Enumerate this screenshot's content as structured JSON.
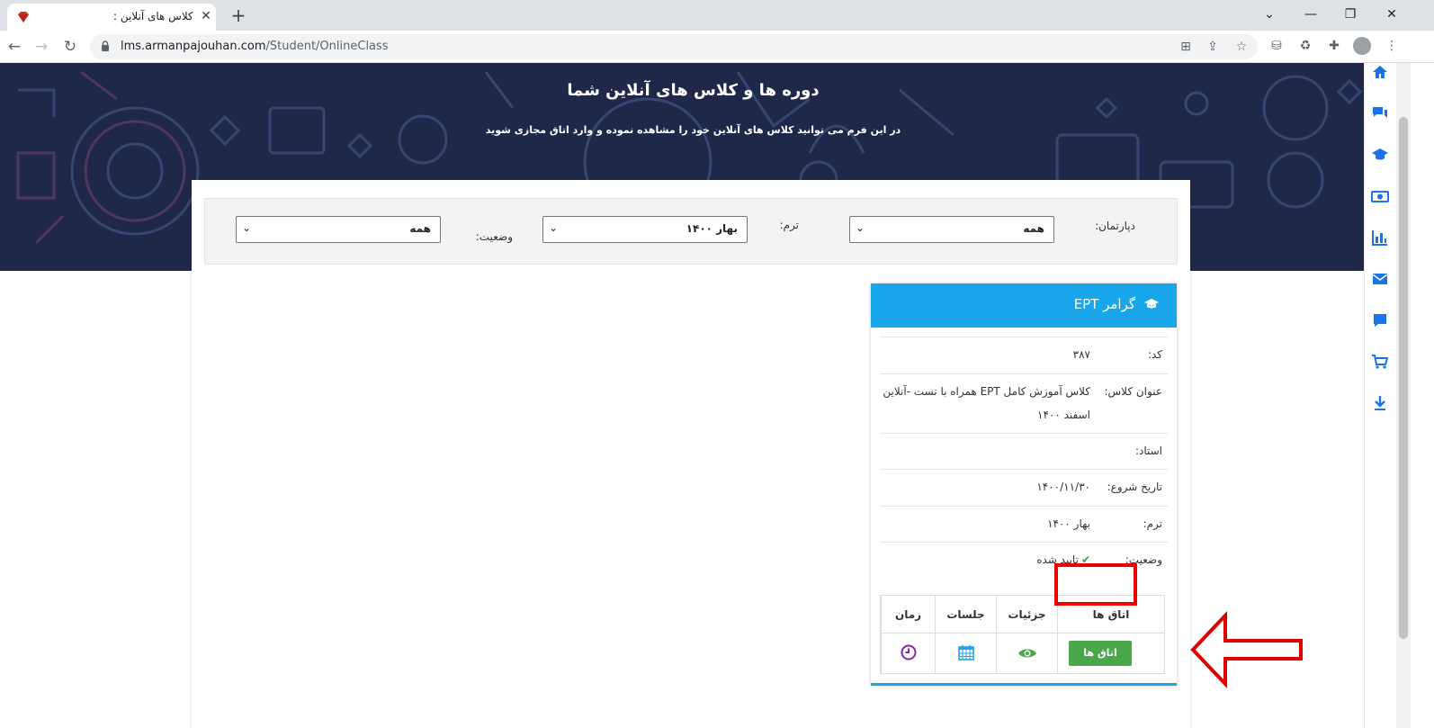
{
  "browser": {
    "tab_title": "کلاس های آنلاین :",
    "tab_close": "✕",
    "new_tab": "+",
    "url_host": "lms.armanpajouhan.com",
    "url_path": "/Student/OnlineClass",
    "controls": {
      "minimize": "—",
      "restore": "❐",
      "close": "✕",
      "tab_list": "⌄"
    },
    "nav": {
      "back": "←",
      "forward": "→",
      "reload": "↻"
    },
    "omni_icons": [
      "translate-icon",
      "share-icon",
      "star-icon"
    ],
    "extension_icons": [
      "extension-a-icon",
      "extension-b-icon",
      "puzzle-icon",
      "profile-icon",
      "menu-icon"
    ]
  },
  "hero": {
    "title": "دوره ها و کلاس های آنلاین شما",
    "subtitle": "در این فرم می توانید کلاس های آنلاین خود را مشاهده نموده و وارد اتاق مجازی شوید"
  },
  "filters": {
    "department_label": "دپارتمان:",
    "department_value": "همه",
    "term_label": "ترم:",
    "term_value": "بهار ۱۴۰۰",
    "status_label": "وضعیت:",
    "status_value": "همه"
  },
  "card": {
    "title": "گرامر EPT",
    "rows": {
      "code_label": "کد:",
      "code_value": "۳۸۷",
      "class_title_label": "عنوان کلاس:",
      "class_title_value": "کلاس آموزش کامل EPT همراه با تست -آنلاین اسفند ۱۴۰۰",
      "teacher_label": "استاد:",
      "teacher_value": "",
      "start_label": "تاریخ شروع:",
      "start_value": "۱۴۰۰/۱۱/۳۰",
      "term_label": "ترم:",
      "term_value": "بهار ۱۴۰۰",
      "status_label": "وضعیت:",
      "status_value": "تایید شده",
      "status_check": "✔"
    },
    "table": {
      "headers": [
        "اتاق ها",
        "جزئیات",
        "جلسات",
        "زمان"
      ],
      "rooms_button": "اتاق ها"
    }
  },
  "colors": {
    "hero_bg": "#1f2848",
    "card_header": "#1aa6ea",
    "rooms_button": "#49a74a",
    "highlight": "#ee0000",
    "sidebar_icons": "#1a73e8"
  },
  "sidebar_icons": [
    "home-icon",
    "chat-icon",
    "graduation-cap-icon",
    "money-icon",
    "bar-chart-icon",
    "mail-icon",
    "comment-icon",
    "cart-icon",
    "download-icon"
  ]
}
